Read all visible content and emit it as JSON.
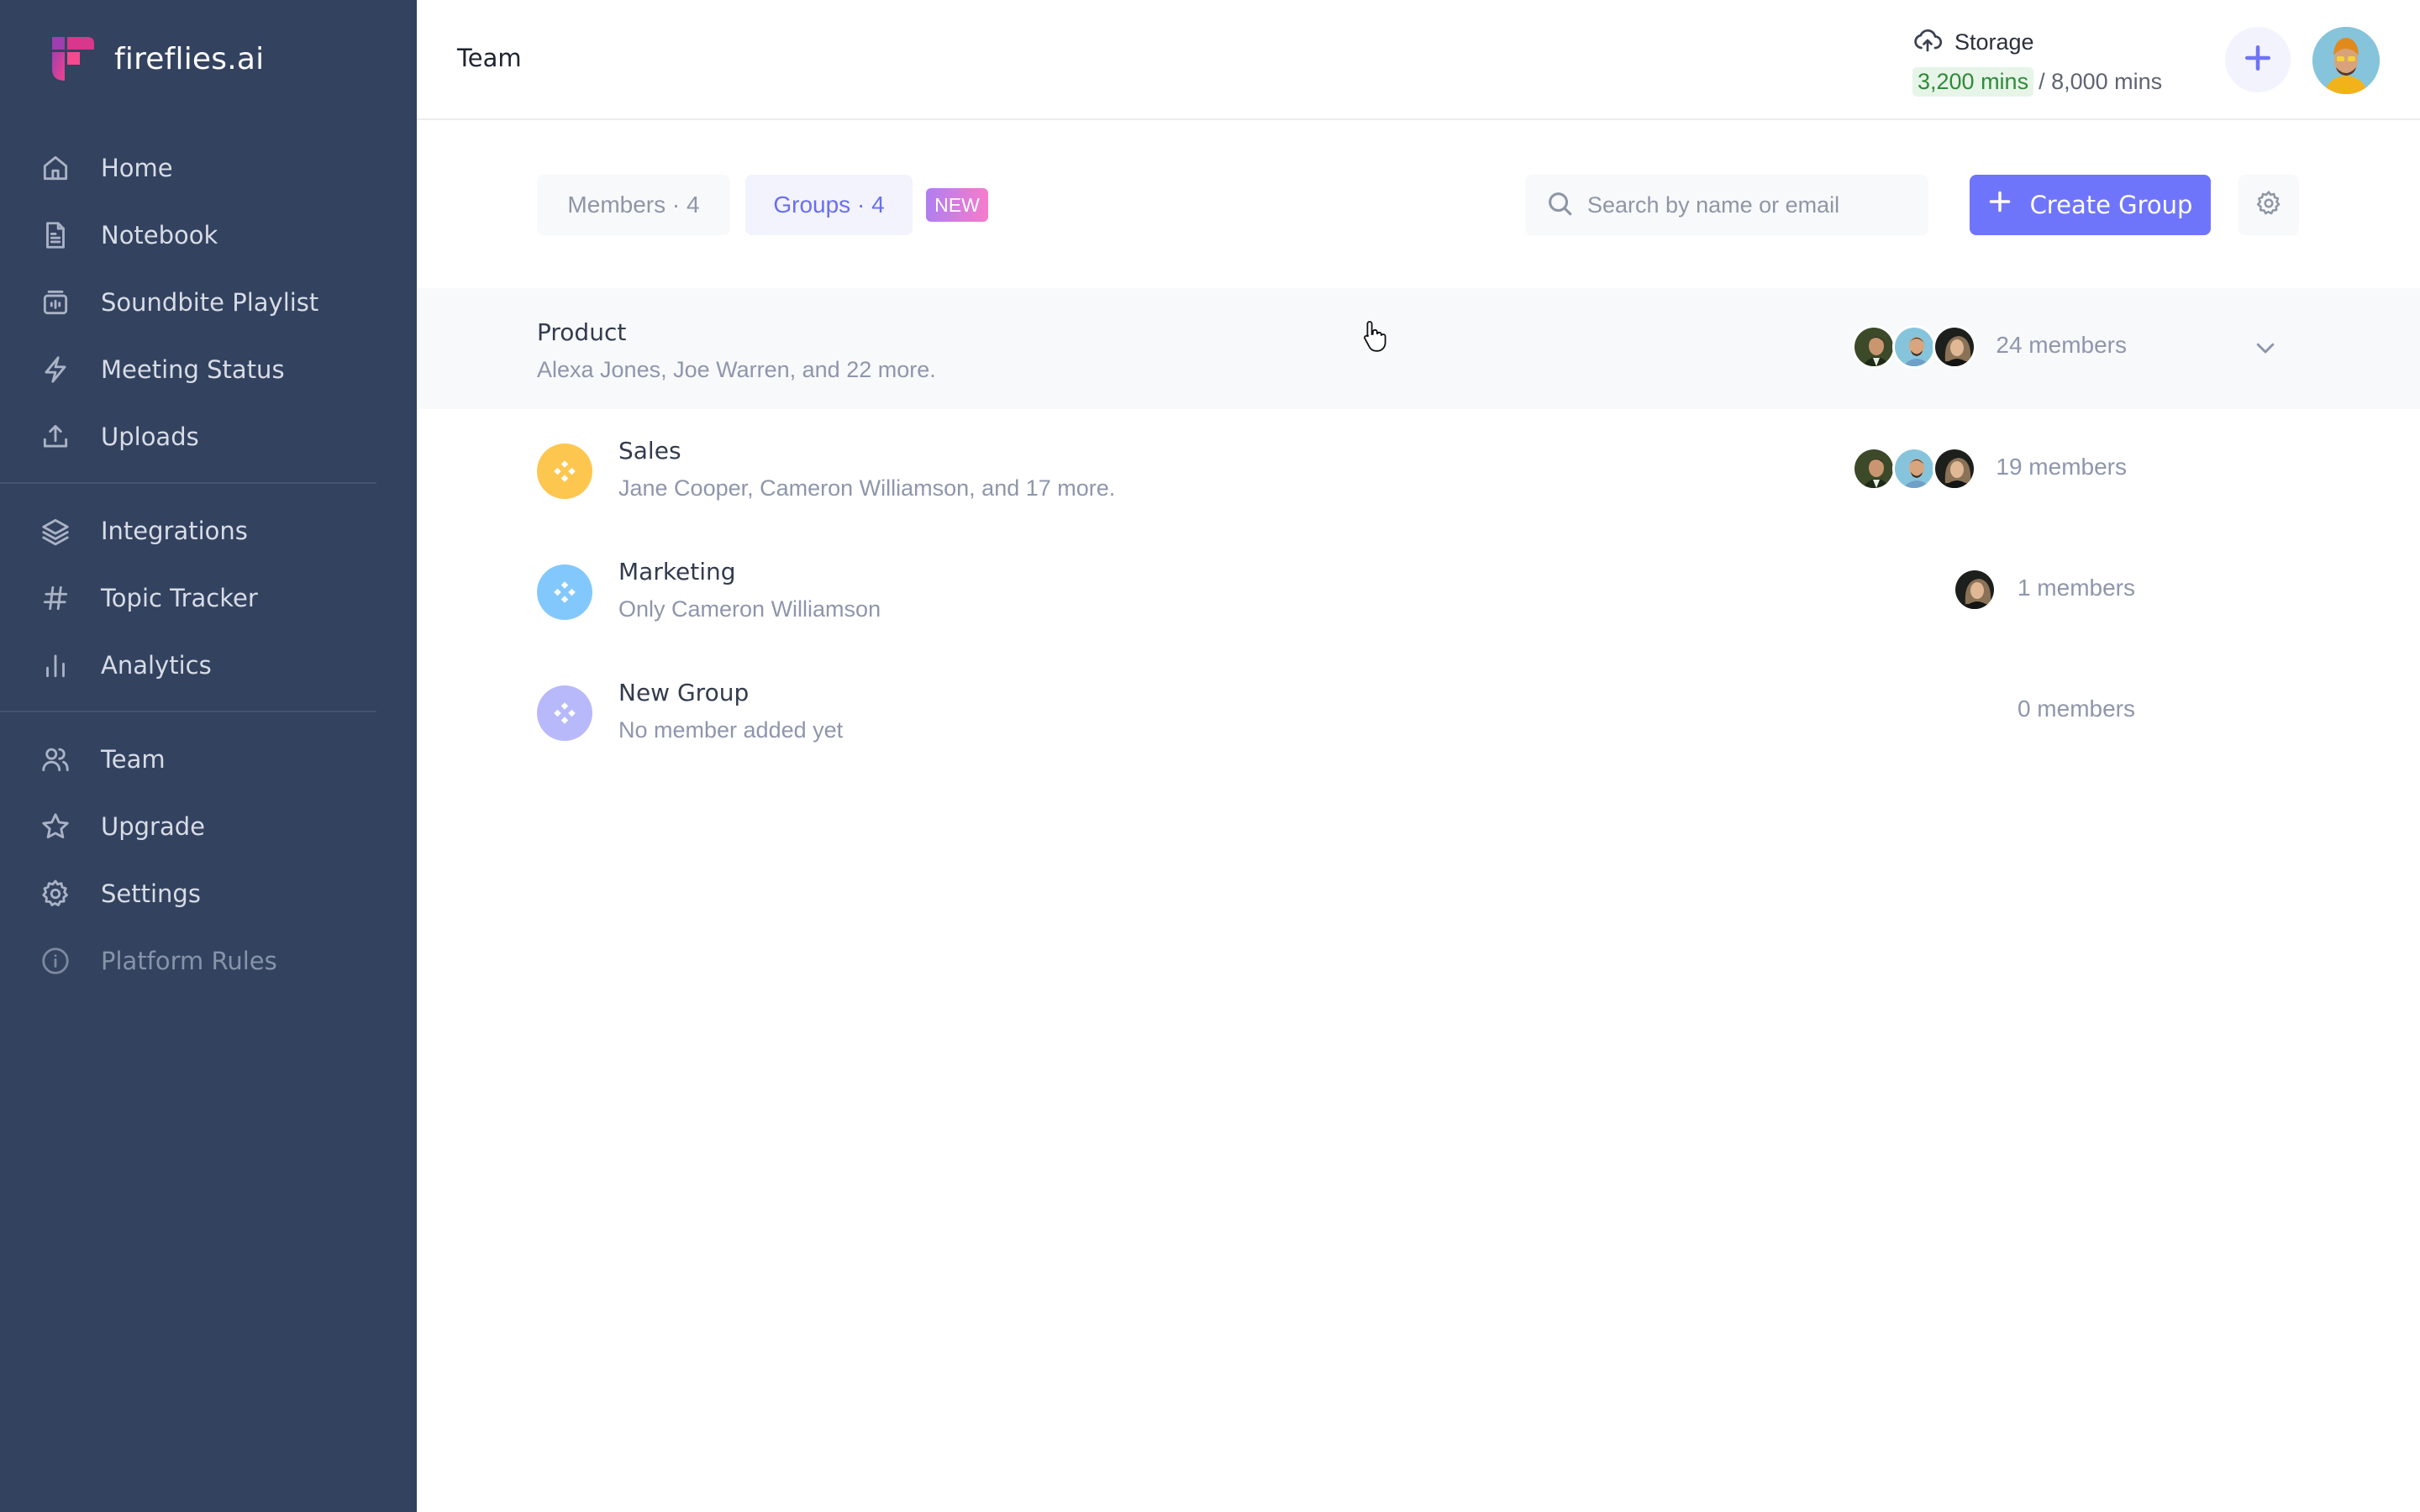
{
  "app": {
    "brand": "fireflies.ai"
  },
  "sidebar": {
    "items": [
      {
        "label": "Home",
        "icon": "home-icon"
      },
      {
        "label": "Notebook",
        "icon": "notebook-icon"
      },
      {
        "label": "Soundbite Playlist",
        "icon": "soundbite-icon"
      },
      {
        "label": "Meeting Status",
        "icon": "lightning-icon"
      },
      {
        "label": "Uploads",
        "icon": "upload-icon"
      },
      {
        "label": "Integrations",
        "icon": "layers-icon"
      },
      {
        "label": "Topic Tracker",
        "icon": "hash-icon"
      },
      {
        "label": "Analytics",
        "icon": "bar-chart-icon"
      },
      {
        "label": "Team",
        "icon": "team-icon"
      },
      {
        "label": "Upgrade",
        "icon": "star-icon"
      },
      {
        "label": "Settings",
        "icon": "gear-icon"
      },
      {
        "label": "Platform Rules",
        "icon": "info-icon"
      }
    ]
  },
  "header": {
    "title": "Team",
    "storage": {
      "label": "Storage",
      "used": "3,200 mins",
      "total": "/ 8,000 mins"
    }
  },
  "toolbar": {
    "tabs": [
      {
        "label": "Members · 4",
        "active": false
      },
      {
        "label": "Groups · 4",
        "active": true
      }
    ],
    "new_badge": "NEW",
    "search_placeholder": "Search by name or email",
    "create_label": "Create Group"
  },
  "colors": {
    "sidebar": "#33425f",
    "accent": "#6f75fb",
    "storage_used": "#2e8b3a"
  },
  "groups": [
    {
      "name": "Product",
      "members_text": "Alexa Jones, Joe Warren, and 22 more.",
      "count": "24 members",
      "icon_color": null,
      "expanded_hover": true
    },
    {
      "name": "Sales",
      "members_text": "Jane Cooper, Cameron Williamson, and 17 more.",
      "count": "19 members",
      "icon_color": "#fdc64f"
    },
    {
      "name": "Marketing",
      "members_text": "Only Cameron Williamson",
      "count": "1 members",
      "icon_color": "#82c8fc"
    },
    {
      "name": "New Group",
      "members_text": "No member added yet",
      "count": "0 members",
      "icon_color": "#b8b9fb"
    }
  ]
}
